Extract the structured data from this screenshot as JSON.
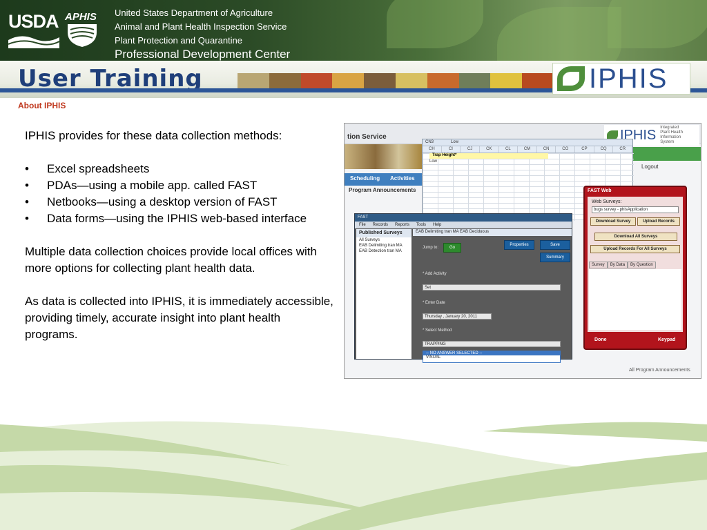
{
  "header": {
    "usda": "USDA",
    "aphis": "APHIS",
    "agency_lines": [
      "United States Department of Agriculture",
      "Animal and Plant Health Inspection Service",
      "Plant Protection and Quarantine",
      "Professional Development Center"
    ]
  },
  "training": {
    "title": "User Training",
    "logo": "IPHIS"
  },
  "section": "About IPHIS",
  "body": {
    "intro": "IPHIS provides for these data collection methods:",
    "bullets": [
      "Excel spreadsheets",
      "PDAs—using a mobile app. called FAST",
      "Netbooks—using a desktop version of FAST",
      "Data forms—using the IPHIS web-based interface"
    ],
    "para2": "Multiple data collection choices provide local offices with more options for collecting plant health data.",
    "para3": "As data is collected into IPHIS, it is immediately accessible, providing timely, accurate insight into plant health programs."
  },
  "screenshot": {
    "web": {
      "service": "tion Service",
      "tabs": [
        "Scheduling",
        "Activities"
      ],
      "announcements": "Program Announcements",
      "logo": "IPHIS",
      "logo_sub": [
        "Integrated",
        "Plant Health",
        "Information",
        "System"
      ],
      "user_bar": "Logout",
      "footer": "All Program Announcements"
    },
    "excel": {
      "name_box": "CN3",
      "formula": "Low",
      "columns": [
        "CH",
        "CI",
        "CJ",
        "CK",
        "CL",
        "CM",
        "CN",
        "CO",
        "CP",
        "CQ",
        "CR"
      ],
      "cell_header": "Trap Height*",
      "cell_value": "Low"
    },
    "app": {
      "title": "FAST",
      "menu": [
        "File",
        "Records",
        "Reports",
        "Tools",
        "Help"
      ],
      "left_header": "Published Surveys",
      "left_items": [
        "All Surveys",
        "EAB Delimiting tran MA",
        "EAB Detection tran MA"
      ],
      "tab": "EAB Delimiting tran MA EAB Deciduous",
      "jump_to": "Jump to:",
      "go": "Go",
      "properties": "Properties",
      "save": "Save",
      "summary": "Summary",
      "add_activity": "* Add Activity",
      "activity_value": "Set",
      "enter_date": "* Enter Date",
      "date_value": "Thursday ,  January  20, 2011",
      "select_method": "* Select Method",
      "method_value": "TRAPPING",
      "options": [
        "-- NO ANSWER SELECTED --",
        "TRAPPING",
        "VISUAL"
      ]
    },
    "phone": {
      "title": "FAST Web",
      "web_surveys": "Web Surveys:",
      "survey_value": "bugs survey - phisApplication",
      "download_survey": "Download Survey",
      "upload_records": "Upload Records",
      "download_all": "Download All Surveys",
      "upload_all": "Upload Records For All Surveys",
      "tabs": [
        "Survey",
        "By Data",
        "By Question"
      ],
      "done": "Done",
      "keypad": "Keypad"
    }
  },
  "colors": {
    "title_blue": "#1f3f7a",
    "section_red": "#c0391f",
    "banner_green": "#2b4a26",
    "swoosh_green": "#c5d9a8"
  }
}
